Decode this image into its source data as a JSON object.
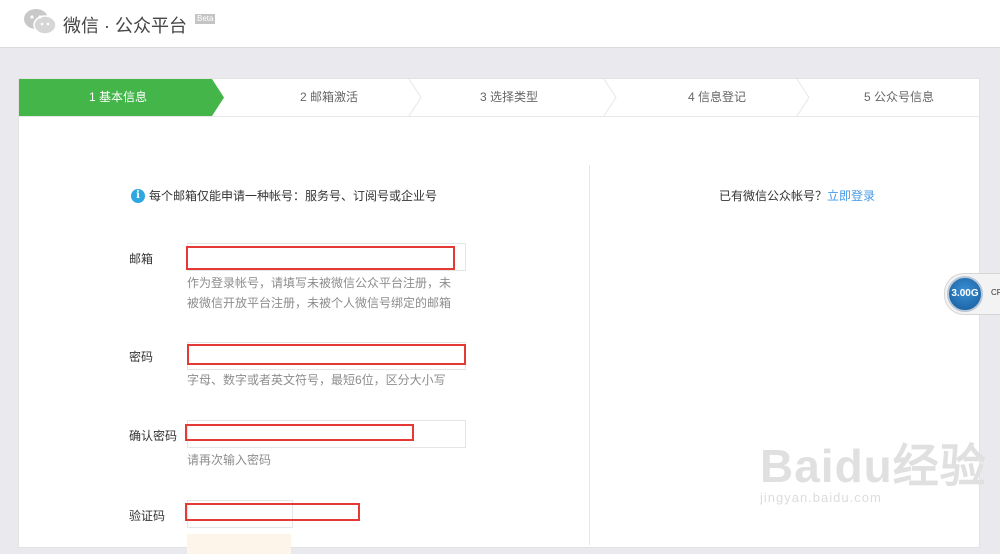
{
  "header": {
    "title": "微信 · 公众平台",
    "beta": "Beta"
  },
  "steps": [
    {
      "label": "1 基本信息",
      "active": true
    },
    {
      "label": "2 邮箱激活",
      "active": false
    },
    {
      "label": "3 选择类型",
      "active": false
    },
    {
      "label": "4 信息登记",
      "active": false
    },
    {
      "label": "5 公众号信息",
      "active": false
    }
  ],
  "form": {
    "notice": "每个邮箱仅能申请一种帐号：服务号、订阅号或企业号",
    "email_label": "邮箱",
    "email_hint": "作为登录帐号，请填写未被微信公众平台注册，未被微信开放平台注册，未被个人微信号绑定的邮箱",
    "email_hint_line1": "作为登录帐号，请填写未被微信公众平台注册，未",
    "email_hint_line2": "被微信开放平台注册，未被个人微信号绑定的邮箱",
    "password_label": "密码",
    "password_hint": "字母、数字或者英文符号，最短6位，区分大小写",
    "confirm_label": "确认密码",
    "confirm_hint": "请再次输入密码",
    "captcha_label": "验证码"
  },
  "side": {
    "login_prompt": "已有微信公众帐号？",
    "login_link": "立即登录"
  },
  "widget": {
    "value": "3.00G",
    "suffix": "CP"
  },
  "watermark": {
    "main": "Baidu经验",
    "sub": "jingyan.baidu.com"
  },
  "colors": {
    "active_step": "#44b549",
    "link": "#459ae9",
    "highlight_box": "#e53935"
  }
}
